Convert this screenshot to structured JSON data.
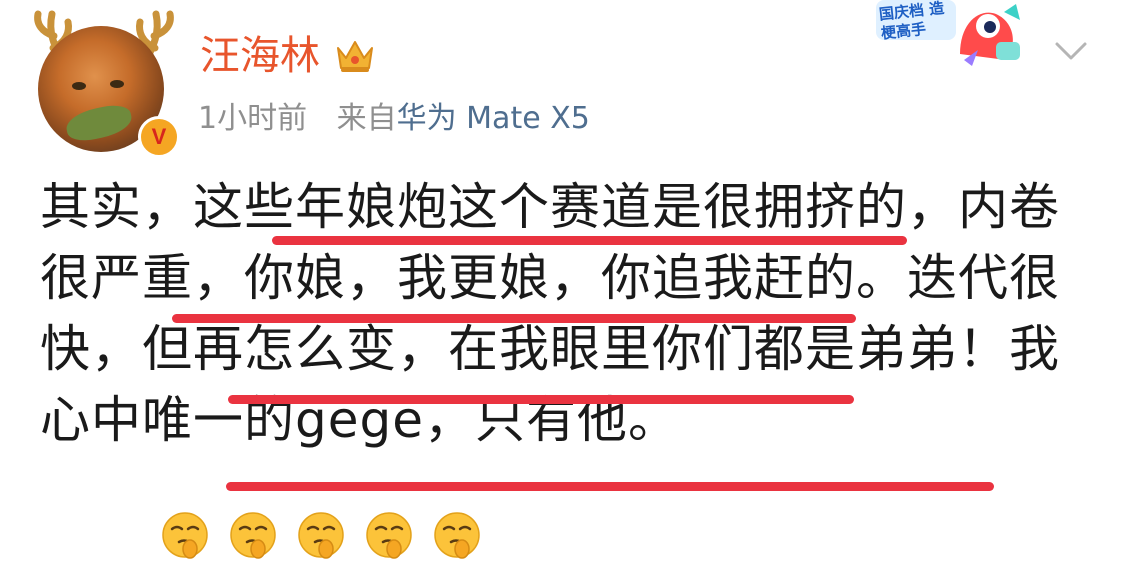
{
  "post": {
    "username": "汪海林",
    "time": "1小时前",
    "source_prefix": "来自",
    "device": "华为 Mate X5",
    "body": "其实，这些年娘炮这个赛道是很拥挤的，内卷很严重，你娘，我更娘，你追我赶的。迭代很快，但再怎么变，在我眼里你们都是弟弟！我心中唯一的gege，只有他。",
    "emoji_names": [
      "shush-face-emoji",
      "shush-face-emoji",
      "shush-face-emoji",
      "shush-face-emoji",
      "shush-face-emoji"
    ]
  },
  "promo": {
    "text": "国庆档 造梗高手"
  },
  "icons": {
    "verified": "verified-v-badge",
    "crown": "crown-icon",
    "menu": "chevron-down-icon"
  },
  "colors": {
    "username": "#e8552c",
    "underline": "#ea3340",
    "meta": "#8f8f8f",
    "device_link": "#4f6e8f"
  }
}
